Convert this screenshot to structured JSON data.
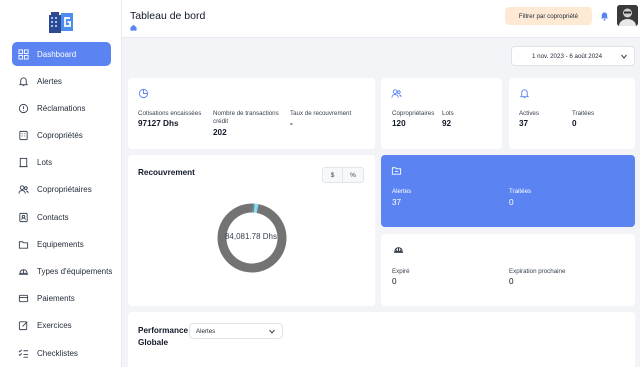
{
  "sidebar": {
    "items": [
      {
        "label": "Dashboard",
        "icon": "grid-icon",
        "active": true
      },
      {
        "label": "Alertes",
        "icon": "bell-icon"
      },
      {
        "label": "Réclamations",
        "icon": "alert-circle-icon"
      },
      {
        "label": "Copropriétés",
        "icon": "building-icon"
      },
      {
        "label": "Lots",
        "icon": "door-icon"
      },
      {
        "label": "Copropriétaires",
        "icon": "users-icon"
      },
      {
        "label": "Contacts",
        "icon": "contact-card-icon"
      },
      {
        "label": "Equipements",
        "icon": "folder-icon"
      },
      {
        "label": "Types d'équipements",
        "icon": "helmet-icon"
      },
      {
        "label": "Paiements",
        "icon": "credit-card-icon"
      },
      {
        "label": "Exercices",
        "icon": "edit-icon"
      },
      {
        "label": "Checklistes",
        "icon": "checklist-icon"
      }
    ]
  },
  "header": {
    "title": "Tableau de bord",
    "filter_label": "Filtrer par copropriété"
  },
  "date_range": "1 nov. 2023 - 6 août 2024",
  "stats": {
    "cotisations_label": "Cotisations encaissées",
    "cotisations_value": "97127 Dhs",
    "transactions_label": "Nombre de transactions crédit",
    "transactions_value": "202",
    "taux_label": "Taux de recouvrement",
    "taux_value": "-"
  },
  "ownership": {
    "coproprietaires_label": "Copropriétaires",
    "coproprietaires_value": "120",
    "lots_label": "Lots",
    "lots_value": "92"
  },
  "alerts": {
    "actives_label": "Actives",
    "actives_value": "37",
    "traitees_label": "Traitées",
    "traitees_value": "0"
  },
  "recouvrement": {
    "title": "Recouvrement",
    "toggle_currency": "$",
    "toggle_percent": "%",
    "total": "84,081.78 Dhs"
  },
  "reclamations": {
    "alertes_label": "Alertes",
    "alertes_value": "37",
    "traitees_label": "Traitées",
    "traitees_value": "0"
  },
  "equipment": {
    "expire_label": "Expiré",
    "expire_value": "0",
    "expiration_label": "Expiration prochaine",
    "expiration_value": "0"
  },
  "performance": {
    "title": "Performance Globale",
    "select_value": "Alertes"
  },
  "colors": {
    "accent": "#5b84f2",
    "filter_bg": "#fde9d4",
    "donut_main": "#737373"
  },
  "chart_data": {
    "type": "pie",
    "title": "Recouvrement",
    "total_label": "84,081.78 Dhs",
    "slices": [
      {
        "value": 0.975,
        "color": "#737373"
      },
      {
        "value": 0.008,
        "color": "#5b84f2"
      },
      {
        "value": 0.008,
        "color": "#86efac"
      },
      {
        "value": 0.009,
        "color": "#7dd3fc"
      }
    ]
  }
}
